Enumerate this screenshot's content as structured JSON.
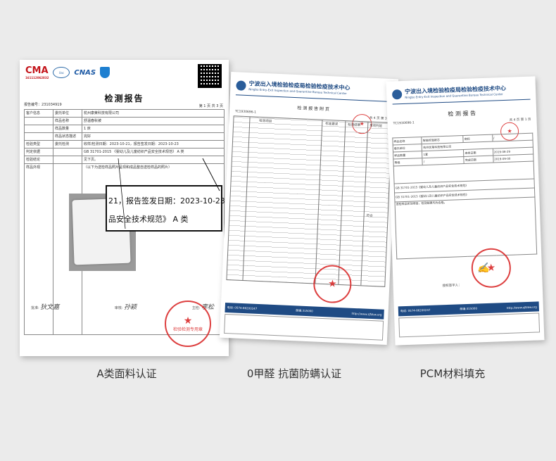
{
  "captions": [
    "A类面料认证",
    "0甲醛 抗菌防螨认证",
    "PCM材料填充"
  ],
  "doc1": {
    "logos": {
      "cma": "CMA",
      "cma_no": "161112062832",
      "cnas": "CNAS"
    },
    "title": "检测报告",
    "report_no_label": "报告编号：",
    "report_no": "231034919",
    "page": "第 1 页 共 3 页",
    "rows": [
      {
        "k": "客户信息",
        "k2": "委托单位",
        "v": "杭州康莱科技有限公司"
      },
      {
        "k": "",
        "k2": "样品名称",
        "v": "舒温春秋被"
      },
      {
        "k": "",
        "k2": "样品数量",
        "v": "1 床"
      },
      {
        "k": "",
        "k2": "样品状态描述",
        "v": "完好"
      },
      {
        "k": "检验类型",
        "k2": "委托检测",
        "v": "收样/检测日期：2023-10-21，报告签发日期：2023-10-23"
      },
      {
        "k": "判定依据",
        "k2": "",
        "v": "GB 31701-2015 《婴幼儿及儿童纺织产品安全技术规范》 A 类"
      },
      {
        "k": "检验结论",
        "k2": "",
        "v": "见下页。"
      },
      {
        "k": "样品外观",
        "k2": "",
        "v": "（以下为送检样品照片呈现和成品整自送检样品的照片）"
      }
    ],
    "zoom_line1": "21，报告签发日期：2023-10-23",
    "zoom_line2": "品安全技术规范》  A 类",
    "signatures": [
      "批准",
      "审核",
      "主检"
    ],
    "sign_names": [
      "狄文嘉",
      "孙颖",
      "李松"
    ],
    "stamp": "检验检测专用章"
  },
  "doc2": {
    "org_cn": "宁波出入境检验检疫局检验检疫技术中心",
    "org_en": "Ningbo Entry-Exit Inspection and Quarantine Bureau Technical Center",
    "title": "检 测 报 告 附 页",
    "report_no": "TC1930696-1",
    "page": "共 4 页 第 3 页",
    "col_headers": [
      "检测项目",
      "标准要求",
      "检测结果",
      "单项判定"
    ],
    "conclusion": "符合",
    "footer_phone": "电话: 0574-86200247",
    "footer_fax": "邮编:315000",
    "footer_web": "http://www.zjfzbw.org"
  },
  "doc3": {
    "org_cn": "宁波出入境检验检疫局检验检疫技术中心",
    "org_en": "Ningbo Entry-Exit Inspection and Quarantine Bureau Technical Center",
    "title": "检 测 报 告",
    "report_no": "TC1930696-1",
    "page": "共 4 页 第 1 页",
    "rows": [
      {
        "a": "样品名称",
        "b": "智能控温被芯",
        "c": "商标",
        "d": "/"
      },
      {
        "a": "委托单位",
        "b": "杭州优莱科技有限公司",
        "c": "",
        "d": ""
      },
      {
        "a": "样品数量",
        "b": "1套",
        "c": "来样日期",
        "d": "2019-08-29"
      },
      {
        "a": "等级",
        "b": "/",
        "c": "完成日期",
        "d": "2019-09-00"
      }
    ],
    "standard": "GB 31701-2015《婴幼儿及儿童纺织产品安全技术规范》",
    "result": "送检样品所测项目，检测结果均为合格。",
    "signer": "授权签字人：",
    "footer_phone": "电话: 0574-86200247",
    "footer_fax": "邮编:315000",
    "footer_web": "http://www.zjfzbw.org"
  }
}
